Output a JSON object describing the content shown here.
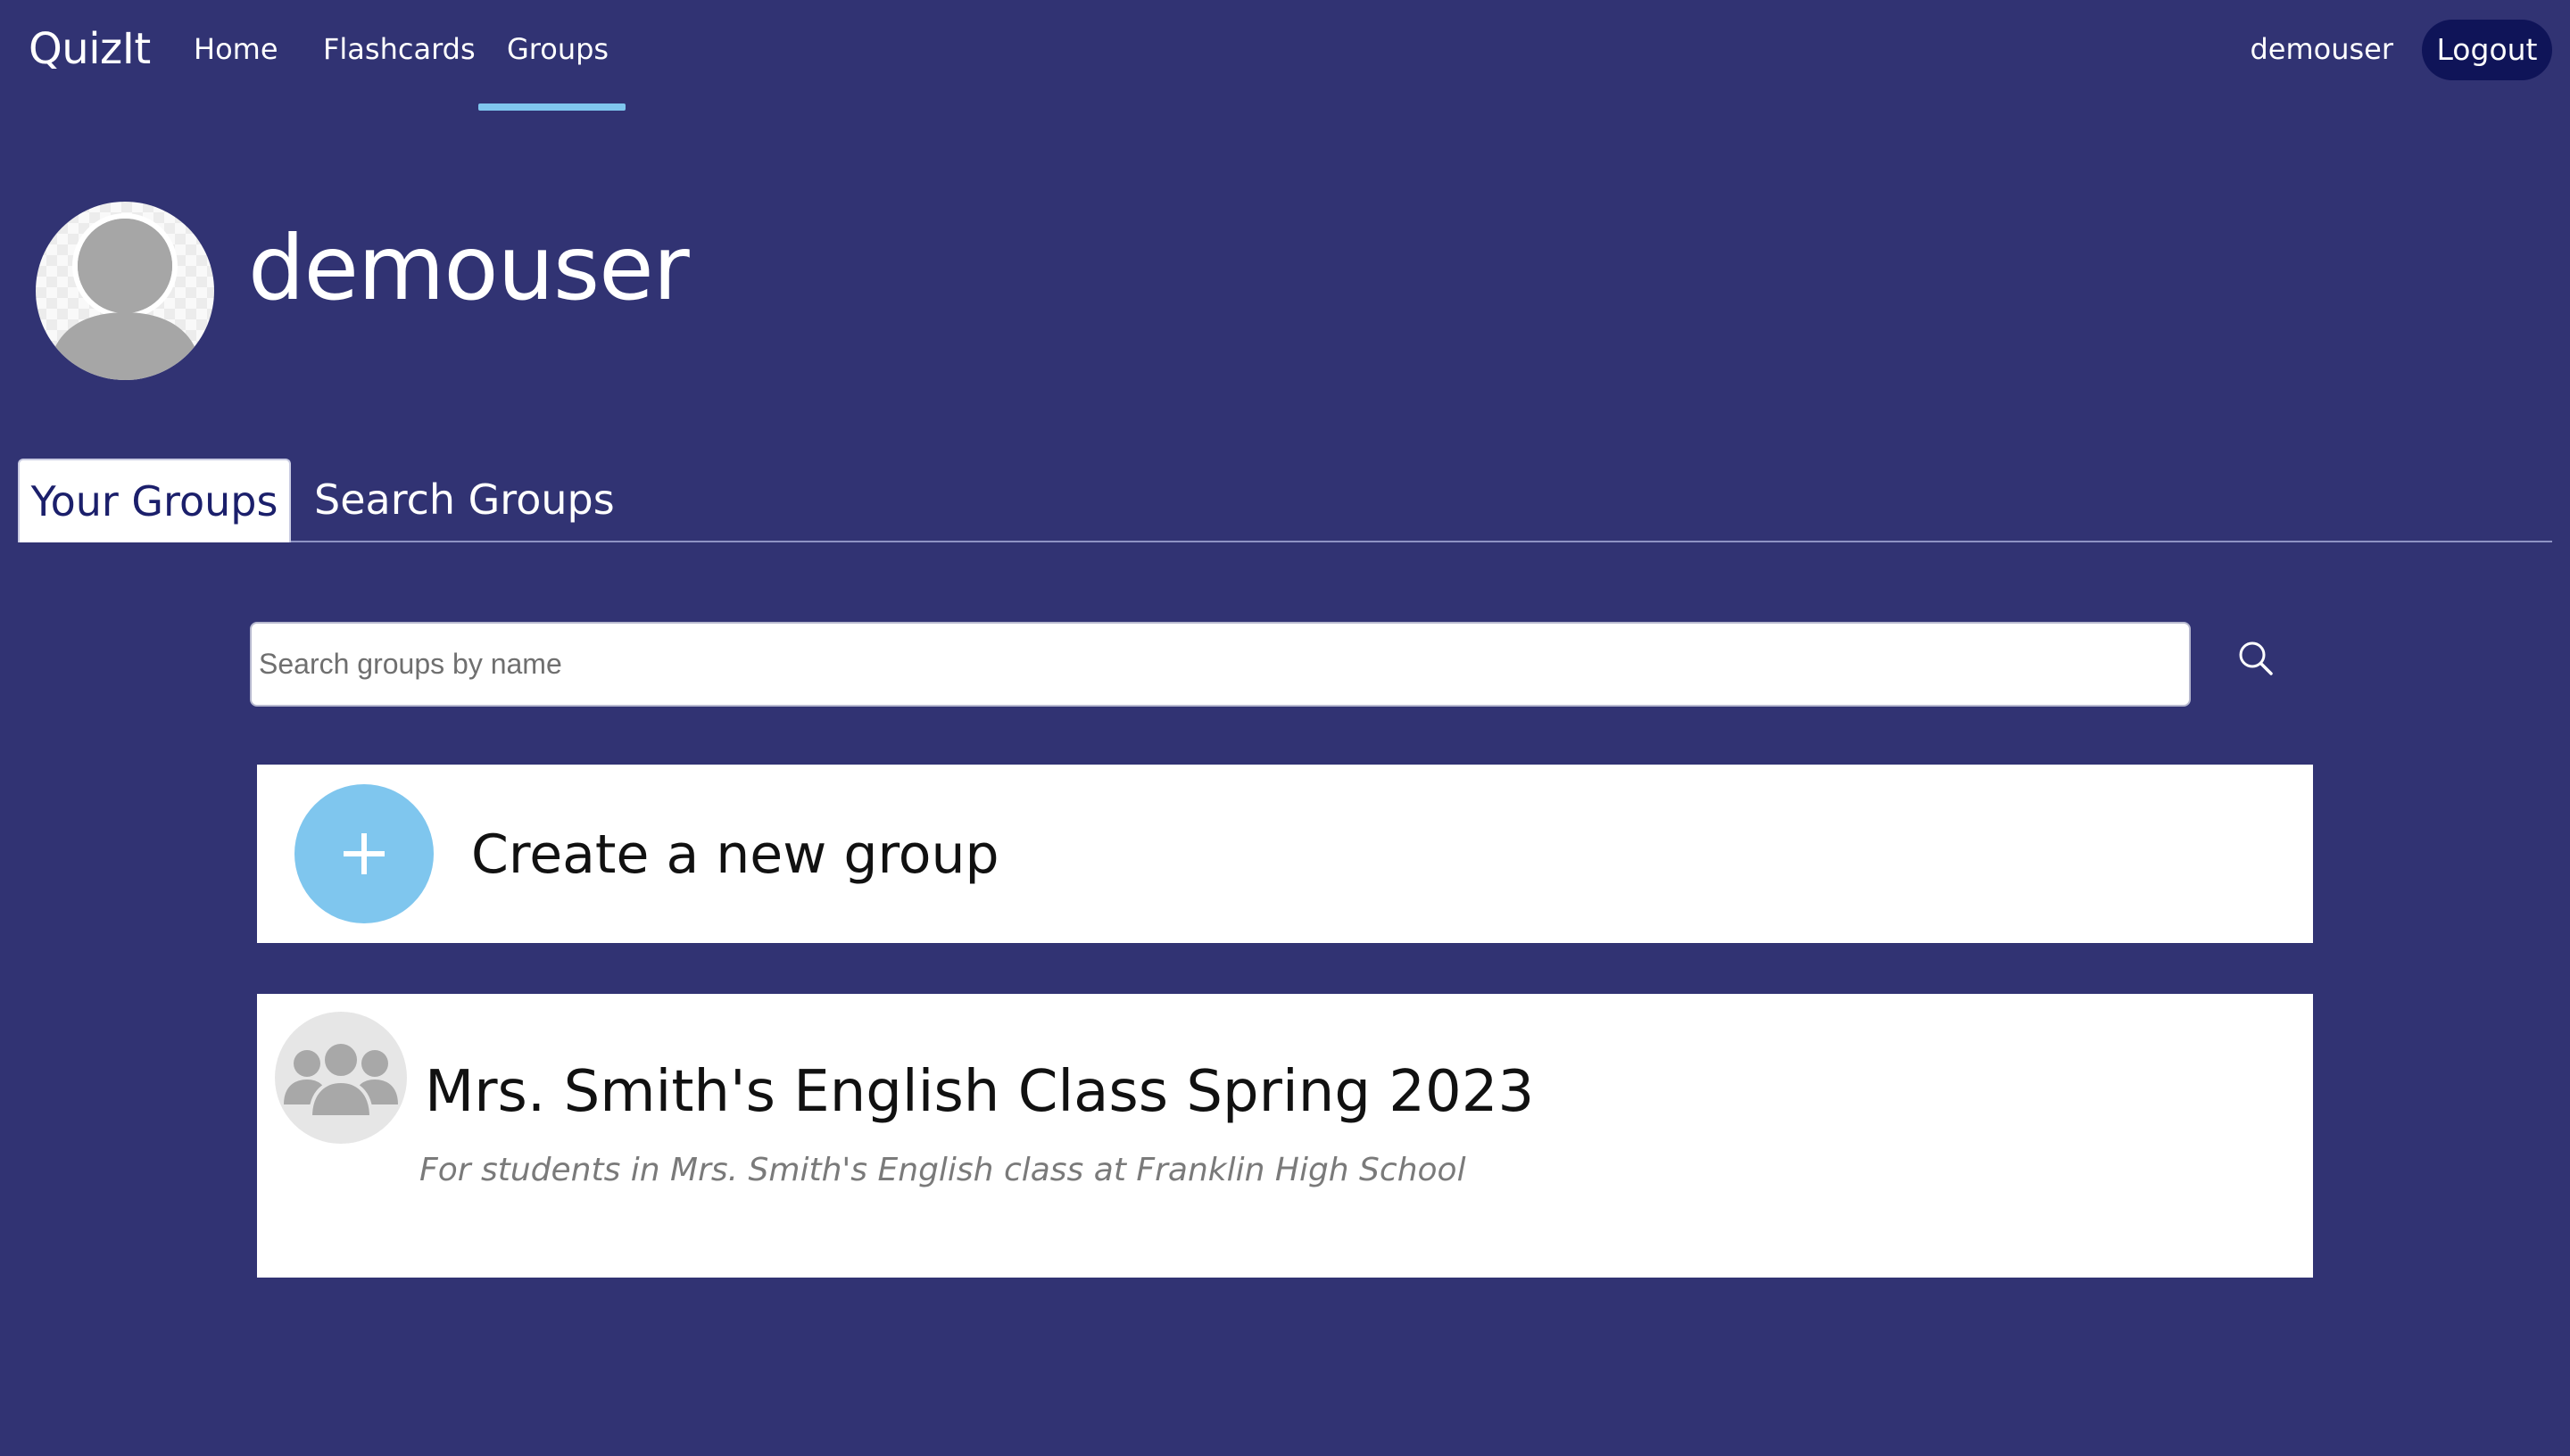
{
  "nav": {
    "brand": "QuizIt",
    "links": [
      {
        "label": "Home"
      },
      {
        "label": "Flashcards"
      },
      {
        "label": "Groups"
      }
    ],
    "active": "Groups",
    "username": "demouser",
    "logout_label": "Logout"
  },
  "profile": {
    "username": "demouser",
    "avatar_icon": "default-user-avatar-icon"
  },
  "tabs": [
    {
      "label": "Your Groups",
      "selected": true
    },
    {
      "label": "Search Groups",
      "selected": false
    }
  ],
  "search": {
    "placeholder": "Search groups by name",
    "value": "",
    "icon": "search-icon"
  },
  "create_card": {
    "label": "Create a new group",
    "icon": "plus-icon"
  },
  "groups": [
    {
      "name": "Mrs. Smith's English Class Spring 2023",
      "description": "For students in Mrs. Smith's English class at Franklin High School",
      "icon": "group-icon"
    }
  ],
  "colors": {
    "background": "#313373",
    "accent": "#7fc6ee",
    "logout_button": "#0f1458",
    "card": "#ffffff"
  }
}
